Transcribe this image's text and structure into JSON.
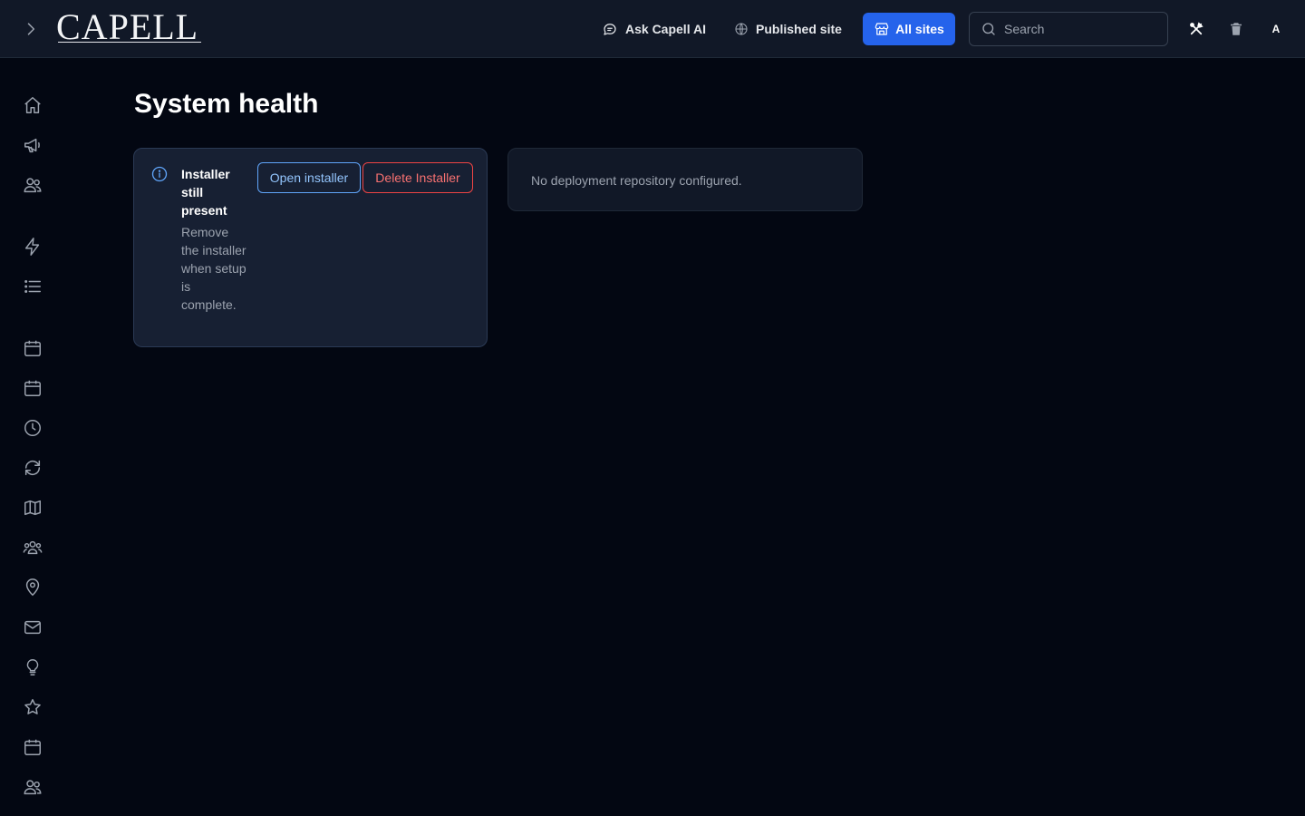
{
  "header": {
    "logo_text": "CAPELL",
    "ask_ai_label": "Ask Capell AI",
    "published_site_label": "Published site",
    "all_sites_label": "All sites",
    "search_placeholder": "Search",
    "avatar_initial": "A"
  },
  "sidebar": {
    "items": [
      {
        "icon": "home-icon"
      },
      {
        "icon": "megaphone-icon"
      },
      {
        "icon": "users-icon"
      },
      {
        "icon": "bolt-icon"
      },
      {
        "icon": "list-icon"
      },
      {
        "icon": "calendar-icon"
      },
      {
        "icon": "calendar-days-icon"
      },
      {
        "icon": "clock-icon"
      },
      {
        "icon": "refresh-icon"
      },
      {
        "icon": "map-icon"
      },
      {
        "icon": "user-group-icon"
      },
      {
        "icon": "map-pin-icon"
      },
      {
        "icon": "envelope-icon"
      },
      {
        "icon": "light-bulb-icon"
      },
      {
        "icon": "star-icon"
      },
      {
        "icon": "calendar-days-icon"
      },
      {
        "icon": "users-icon"
      }
    ]
  },
  "main": {
    "title": "System health",
    "installer_alert": {
      "title": "Installer still present",
      "description": "Remove the installer when setup is complete.",
      "open_label": "Open installer",
      "delete_label": "Delete Installer"
    },
    "deployment": {
      "message": "No deployment repository configured."
    }
  },
  "colors": {
    "background": "#030712",
    "topbar": "#111827",
    "accent": "#2563eb",
    "danger": "#ef4444",
    "info": "#60a5fa"
  }
}
